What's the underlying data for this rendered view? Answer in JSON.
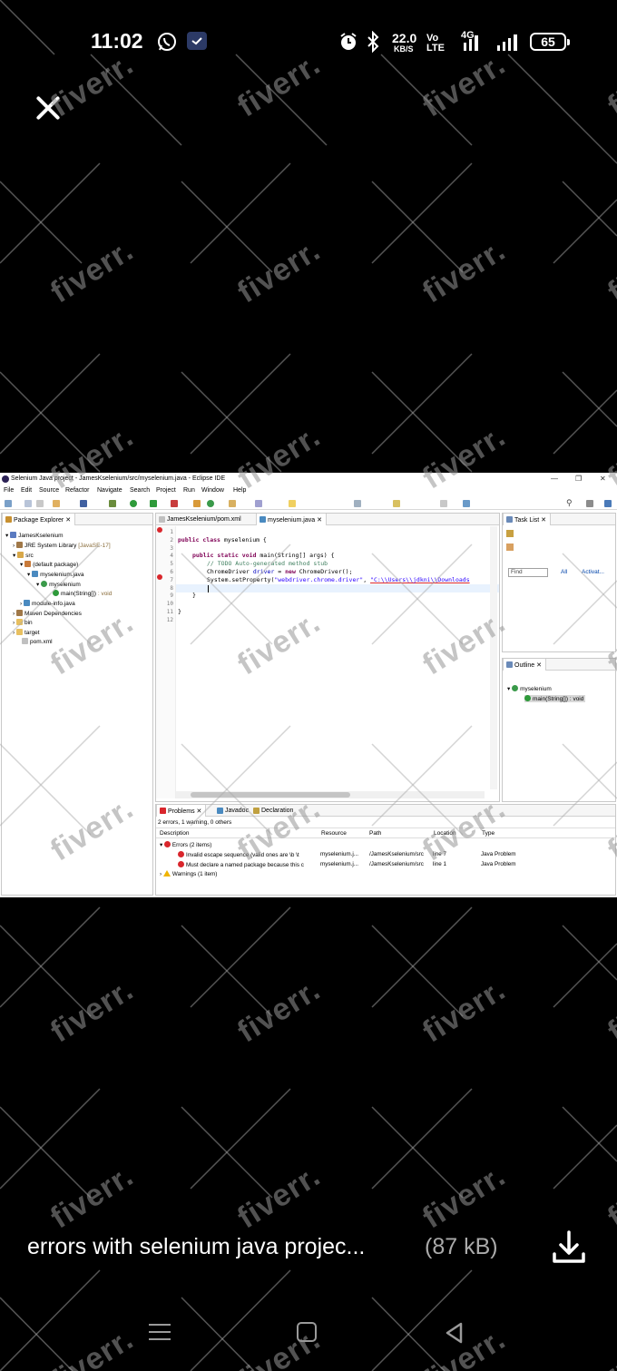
{
  "status_bar": {
    "time": "11:02",
    "net_speed_value": "22.0",
    "net_speed_unit": "KB/S",
    "volte_top": "Vo",
    "volte_bottom": "LTE",
    "network_type": "4G",
    "battery": "65",
    "icons": [
      "whatsapp-icon",
      "notification-icon",
      "alarm-icon",
      "bluetooth-icon",
      "signal-icon",
      "battery-icon"
    ]
  },
  "watermark": "fiverr.",
  "eclipse": {
    "window_title": "Selenium Java project - JamesKselenium/src/myselenium.java - Eclipse IDE",
    "menu": [
      "File",
      "Edit",
      "Source",
      "Refactor",
      "Navigate",
      "Search",
      "Project",
      "Run",
      "Window",
      "Help"
    ],
    "package_explorer": {
      "tab": "Package Explorer",
      "items": [
        {
          "label": "JamesKselenium",
          "extra": ""
        },
        {
          "label": "JRE System Library",
          "extra": "[JavaSE-17]"
        },
        {
          "label": "src",
          "extra": ""
        },
        {
          "label": "(default package)",
          "extra": ""
        },
        {
          "label": "myselenium.java",
          "extra": ""
        },
        {
          "label": "myselenium",
          "extra": ""
        },
        {
          "label": "main(String[])",
          "extra": ": void"
        },
        {
          "label": "module-info.java",
          "extra": ""
        },
        {
          "label": "Maven Dependencies",
          "extra": ""
        },
        {
          "label": "bin",
          "extra": ""
        },
        {
          "label": "target",
          "extra": ""
        },
        {
          "label": "pom.xml",
          "extra": ""
        }
      ]
    },
    "editor": {
      "tabs": [
        "JamesKselenium/pom.xml",
        "myselenium.java"
      ],
      "line_numbers": [
        "1",
        "2",
        "3",
        "4",
        "5",
        "6",
        "7",
        "8",
        "9",
        "10",
        "11",
        "12"
      ],
      "code": {
        "l2_kw": "public class",
        "l2_rest": " myselenium {",
        "l4_kw": "public static void",
        "l4_rest": " main(String[] args) {",
        "l5": "// TODO Auto-generated method stub",
        "l6_type": "ChromeDriver",
        "l6_var": " driver",
        "l6_mid": " = ",
        "l6_kw": "new",
        "l6_rest": " ChromeDriver();",
        "l7_pre": "System.setProperty(",
        "l7_str1": "\"webdriver.chrome.driver\"",
        "l7_sep": ", ",
        "l7_str2": "\"C:\\\\Users\\\\jdkni\\\\Downloads",
        "l9": "}",
        "l11": "}"
      }
    },
    "task_list": {
      "tab": "Task List",
      "find_placeholder": "Find",
      "all_label": "All",
      "activate_label": "Activat..."
    },
    "outline": {
      "tab": "Outline",
      "items": [
        {
          "label": "myselenium",
          "extra": ""
        },
        {
          "label": "main(String[])",
          "extra": ": void"
        }
      ]
    },
    "problems": {
      "tabs": [
        "Problems",
        "Javadoc",
        "Declaration"
      ],
      "summary": "2 errors, 1 warning, 0 others",
      "columns": [
        "Description",
        "Resource",
        "Path",
        "Location",
        "Type"
      ],
      "errors_group": "Errors (2 items)",
      "rows": [
        {
          "description": "Invalid escape sequence (valid ones are  \\b  \\t",
          "resource": "myselenium.j...",
          "path": "/JamesKselenium/src",
          "location": "line 7",
          "type": "Java Problem"
        },
        {
          "description": "Must declare a named package because this c",
          "resource": "myselenium.j...",
          "path": "/JamesKselenium/src",
          "location": "line 1",
          "type": "Java Problem"
        }
      ],
      "warnings_group": "Warnings (1 item)"
    }
  },
  "attachment": {
    "filename": "errors with selenium java projec...",
    "size": "(87 kB)"
  }
}
